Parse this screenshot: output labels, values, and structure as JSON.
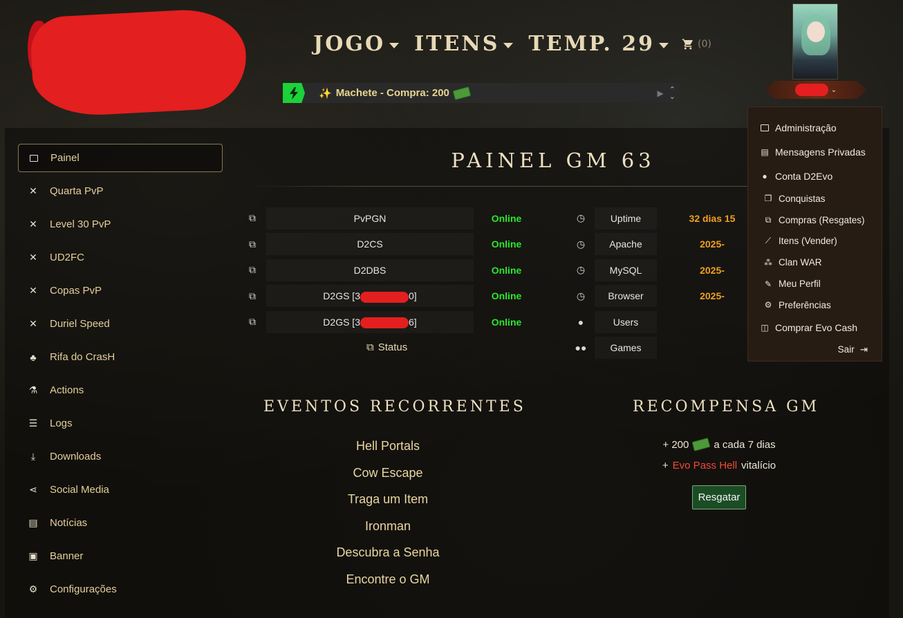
{
  "header": {
    "nav": [
      {
        "label": "JOGO"
      },
      {
        "label": "ITENS"
      },
      {
        "label": "TEMP. 29"
      }
    ],
    "cart_count": "(0)",
    "ticker_text": "Machete - Compra: 200"
  },
  "sidebar": {
    "items": [
      {
        "label": "Painel",
        "icon": "terminal-icon"
      },
      {
        "label": "Quarta PvP",
        "icon": "swords-icon"
      },
      {
        "label": "Level 30 PvP",
        "icon": "swords-icon"
      },
      {
        "label": "UD2FC",
        "icon": "swords-icon"
      },
      {
        "label": "Copas PvP",
        "icon": "swords-icon"
      },
      {
        "label": "Duriel Speed",
        "icon": "swords-icon"
      },
      {
        "label": "Rifa do CrasH",
        "icon": "clover-icon"
      },
      {
        "label": "Actions",
        "icon": "flask-icon"
      },
      {
        "label": "Logs",
        "icon": "list-icon"
      },
      {
        "label": "Downloads",
        "icon": "download-icon"
      },
      {
        "label": "Social Media",
        "icon": "share-icon"
      },
      {
        "label": "Notícias",
        "icon": "newspaper-icon"
      },
      {
        "label": "Banner",
        "icon": "image-icon"
      },
      {
        "label": "Configurações",
        "icon": "gear-icon"
      }
    ]
  },
  "main": {
    "title": "PAINEL GM 63",
    "servers": [
      {
        "name": "PvPGN",
        "status": "Online"
      },
      {
        "name": "D2CS",
        "status": "Online"
      },
      {
        "name": "D2DBS",
        "status": "Online"
      },
      {
        "name_prefix": "D2GS [3",
        "name_suffix": "0]",
        "status": "Online"
      },
      {
        "name_prefix": "D2GS [3",
        "name_suffix": "6]",
        "status": "Online"
      }
    ],
    "status_link": "Status",
    "services": [
      {
        "name": "Uptime",
        "value": "32 dias 15"
      },
      {
        "name": "Apache",
        "value": "2025-"
      },
      {
        "name": "MySQL",
        "value": "2025-"
      },
      {
        "name": "Browser",
        "value": "2025-"
      },
      {
        "name": "Users",
        "value": ""
      },
      {
        "name": "Games",
        "value": ""
      }
    ],
    "events_title": "EVENTOS RECORRENTES",
    "events": [
      "Hell Portals",
      "Cow Escape",
      "Traga um Item",
      "Ironman",
      "Descubra a Senha",
      "Encontre o GM"
    ],
    "reward_title": "RECOMPENSA GM",
    "reward_line1_prefix": "+ 200",
    "reward_line1_suffix": "a cada 7 dias",
    "reward_line2_prefix": "+",
    "reward_line2_evo": "Evo Pass Hell",
    "reward_line2_suffix": "vitalício",
    "redeem_label": "Resgatar"
  },
  "user_menu": {
    "items": [
      {
        "label": "Administração"
      },
      {
        "label": "Mensagens Privadas"
      },
      {
        "label": "Conta D2Evo"
      }
    ],
    "sub_items": [
      {
        "label": "Conquistas"
      },
      {
        "label": "Compras (Resgates)"
      },
      {
        "label": "Itens (Vender)"
      },
      {
        "label": "Clan WAR"
      },
      {
        "label": "Meu Perfil"
      },
      {
        "label": "Preferências"
      }
    ],
    "buy_label": "Comprar Evo Cash",
    "logout_label": "Sair"
  },
  "colors": {
    "online": "#2ae62e",
    "accent_gold": "#e3cf9c",
    "date_orange": "#f0a020",
    "evo_red": "#f04a3a"
  }
}
